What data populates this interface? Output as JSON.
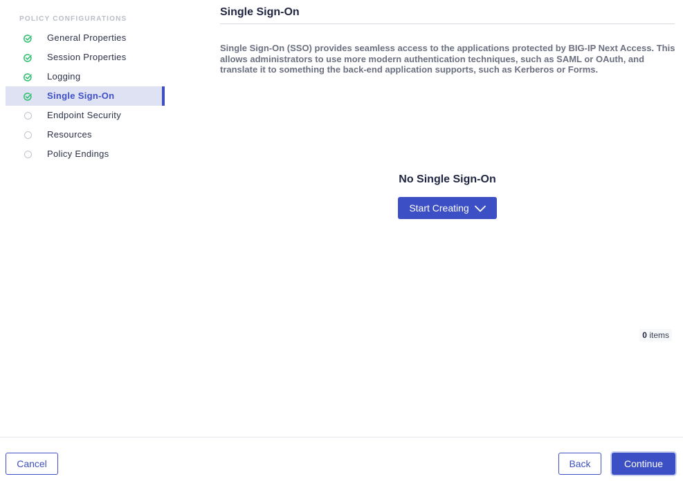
{
  "sidebar": {
    "heading": "POLICY CONFIGURATIONS",
    "items": [
      {
        "label": "General Properties",
        "status": "complete"
      },
      {
        "label": "Session Properties",
        "status": "complete"
      },
      {
        "label": "Logging",
        "status": "complete"
      },
      {
        "label": "Single Sign-On",
        "status": "complete",
        "active": true
      },
      {
        "label": "Endpoint Security",
        "status": "pending"
      },
      {
        "label": "Resources",
        "status": "pending"
      },
      {
        "label": "Policy Endings",
        "status": "pending"
      }
    ]
  },
  "main": {
    "title": "Single Sign-On",
    "description": "Single Sign-On (SSO) provides seamless access to the applications protected by BIG-IP Next Access. This allows administrators to use more modern authentication techniques, such as SAML or OAuth, and translate it to something the back-end application supports, such as Kerberos or Forms.",
    "empty_title": "No Single Sign-On",
    "start_button": "Start Creating",
    "count_value": "0",
    "count_label": "items"
  },
  "footer": {
    "cancel": "Cancel",
    "back": "Back",
    "continue": "Continue"
  },
  "colors": {
    "accent": "#3d4fc4",
    "success": "#2fbf71",
    "active_bg": "#dfe2f3"
  }
}
